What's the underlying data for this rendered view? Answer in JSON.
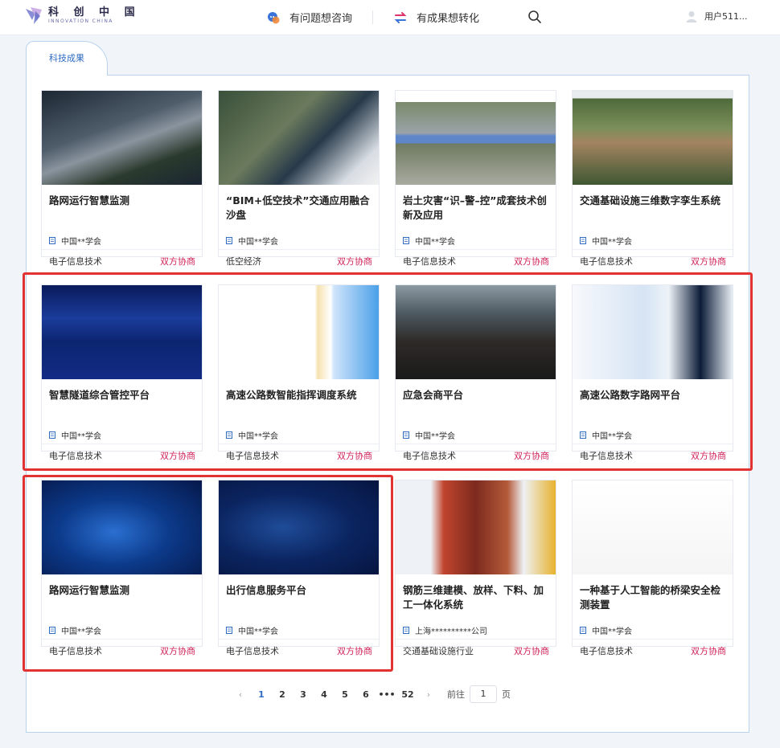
{
  "brand": {
    "cn": "科 创 中 国",
    "en": "INNOVATION CHINA"
  },
  "nav": {
    "consult": "有问题想咨询",
    "transform": "有成果想转化"
  },
  "user": {
    "name": "用户511..."
  },
  "tab": {
    "label": "科技成果"
  },
  "cards": [
    {
      "title": "路网运行智慧监测",
      "org": "中国**学会",
      "category": "电子信息技术",
      "negotiation": "双方协商"
    },
    {
      "title": "“BIM+低空技术”交通应用融合沙盘",
      "org": "中国**学会",
      "category": "低空经济",
      "negotiation": "双方协商"
    },
    {
      "title": "岩土灾害“识–警–控”成套技术创新及应用",
      "org": "中国**学会",
      "category": "电子信息技术",
      "negotiation": "双方协商"
    },
    {
      "title": "交通基础设施三维数字孪生系统",
      "org": "中国**学会",
      "category": "电子信息技术",
      "negotiation": "双方协商"
    },
    {
      "title": "智慧隧道综合管控平台",
      "org": "中国**学会",
      "category": "电子信息技术",
      "negotiation": "双方协商"
    },
    {
      "title": "高速公路数智能指挥调度系统",
      "org": "中国**学会",
      "category": "电子信息技术",
      "negotiation": "双方协商"
    },
    {
      "title": "应急会商平台",
      "org": "中国**学会",
      "category": "电子信息技术",
      "negotiation": "双方协商"
    },
    {
      "title": "高速公路数字路网平台",
      "org": "中国**学会",
      "category": "电子信息技术",
      "negotiation": "双方协商"
    },
    {
      "title": "路网运行智慧监测",
      "org": "中国**学会",
      "category": "电子信息技术",
      "negotiation": "双方协商"
    },
    {
      "title": "出行信息服务平台",
      "org": "中国**学会",
      "category": "电子信息技术",
      "negotiation": "双方协商"
    },
    {
      "title": "钢筋三维建模、放样、下料、加工一体化系统",
      "org": "上海**********公司",
      "category": "交通基础设施行业",
      "negotiation": "双方协商"
    },
    {
      "title": "一种基于人工智能的桥梁安全检测装置",
      "org": "中国**学会",
      "category": "电子信息技术",
      "negotiation": "双方协商"
    }
  ],
  "pagination": {
    "prev": "‹",
    "pages": [
      "1",
      "2",
      "3",
      "4",
      "5",
      "6",
      "•••",
      "52"
    ],
    "next": "›",
    "goto_label": "前往",
    "goto_value": "1",
    "goto_suffix": "页",
    "current": "1"
  },
  "colors": {
    "accent": "#2f6cc2",
    "negotiation": "#d0245b",
    "highlight": "#e23232",
    "border": "#b9d3ee"
  },
  "icons": {
    "consult": "chat-bubble-icon",
    "transform": "transfer-icon",
    "search": "search-icon",
    "user": "user-avatar-icon",
    "org": "building-icon"
  }
}
